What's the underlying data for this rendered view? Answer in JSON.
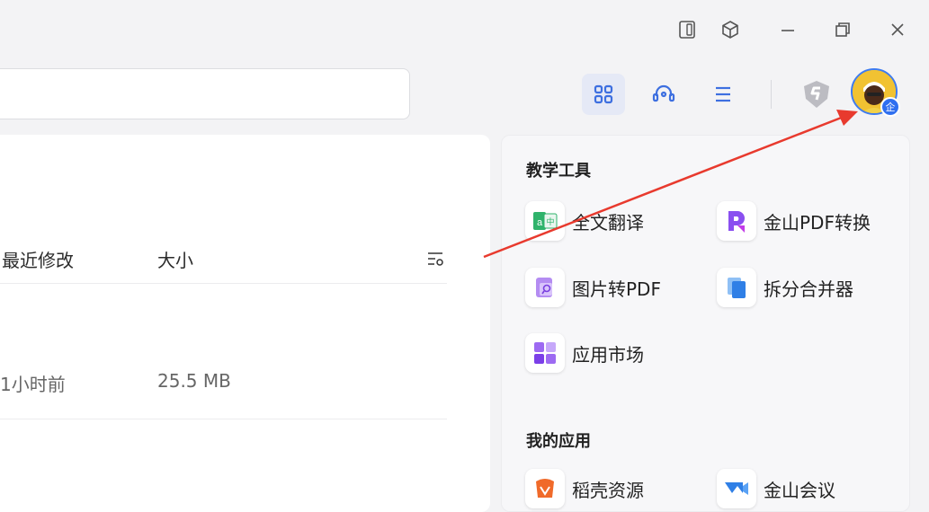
{
  "window_controls": [
    {
      "name": "tablet-mode-icon"
    },
    {
      "name": "cube-icon"
    },
    {
      "name": "minimize-icon"
    },
    {
      "name": "restore-icon"
    },
    {
      "name": "close-icon"
    }
  ],
  "search": {
    "placeholder": ""
  },
  "toolbar": {
    "icons": [
      "grid-view-icon",
      "headset-icon",
      "menu-list-icon",
      "shield-s-icon"
    ],
    "avatar_badge": "企"
  },
  "file_list": {
    "columns": {
      "modified": "最近修改",
      "size": "大小"
    },
    "rows": [
      {
        "modified": "1小时前",
        "size": "25.5 MB"
      }
    ]
  },
  "tools_panel": {
    "section1_title": "教学工具",
    "section1_apps": [
      {
        "label": "全文翻译",
        "icon": "translate-icon"
      },
      {
        "label": "金山PDF转换",
        "icon": "pdf-convert-icon"
      },
      {
        "label": "图片转PDF",
        "icon": "image-to-pdf-icon"
      },
      {
        "label": "拆分合并器",
        "icon": "split-merge-icon"
      },
      {
        "label": "应用市场",
        "icon": "app-market-icon"
      }
    ],
    "section2_title": "我的应用",
    "section2_apps": [
      {
        "label": "稻壳资源",
        "icon": "docer-icon"
      },
      {
        "label": "金山会议",
        "icon": "meeting-icon"
      }
    ]
  },
  "colors": {
    "accent": "#3d7bf0",
    "arrow": "#e83a2e",
    "active_tool_bg": "#e5e9f6"
  }
}
